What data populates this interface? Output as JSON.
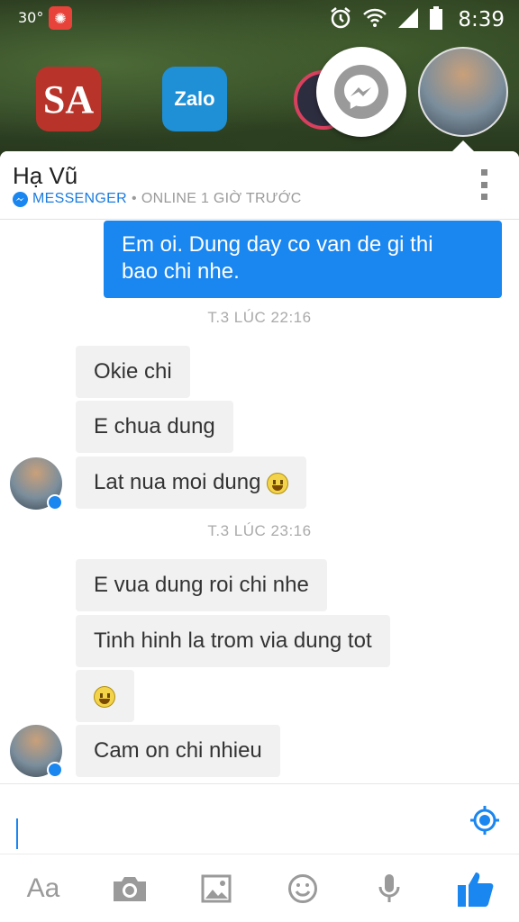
{
  "status_bar": {
    "temperature": "30°",
    "time": "8:39"
  },
  "home_icons": {
    "sa_label": "SA",
    "zalo_label": "Zalo"
  },
  "header": {
    "contact_name": "Hạ Vũ",
    "platform_label": "MESSENGER",
    "separator": "•",
    "presence": "ONLINE 1 GIỜ TRƯỚC"
  },
  "messages": [
    {
      "direction": "out",
      "text_line1": "Em oi. Dung day co van de gi thi",
      "text_line2": "bao chi nhe."
    },
    {
      "type": "timestamp",
      "text": "T.3 LÚC 22:16"
    },
    {
      "direction": "in",
      "text": "Okie chi"
    },
    {
      "direction": "in",
      "text": "E chua dung"
    },
    {
      "direction": "in",
      "text": "Lat nua moi dung",
      "emoji": "smiley-icon"
    },
    {
      "type": "timestamp",
      "text": "T.3 LÚC 23:16"
    },
    {
      "direction": "in",
      "text": "E vua dung roi chi nhe"
    },
    {
      "direction": "in",
      "text": "Tinh hinh la trom via dung tot"
    },
    {
      "direction": "in",
      "emoji": "smiley-icon"
    },
    {
      "direction": "in",
      "text": "Cam on chi nhieu"
    }
  ],
  "composer": {
    "placeholder": "",
    "value": ""
  },
  "toolbar": {
    "text_tool_label": "Aa",
    "icons": [
      "camera-icon",
      "gallery-icon",
      "emoji-icon",
      "microphone-icon",
      "like-icon"
    ]
  },
  "colors": {
    "accent": "#1a86f0",
    "incoming_bubble": "#f1f1f1",
    "timestamp": "#aaaaaa"
  }
}
